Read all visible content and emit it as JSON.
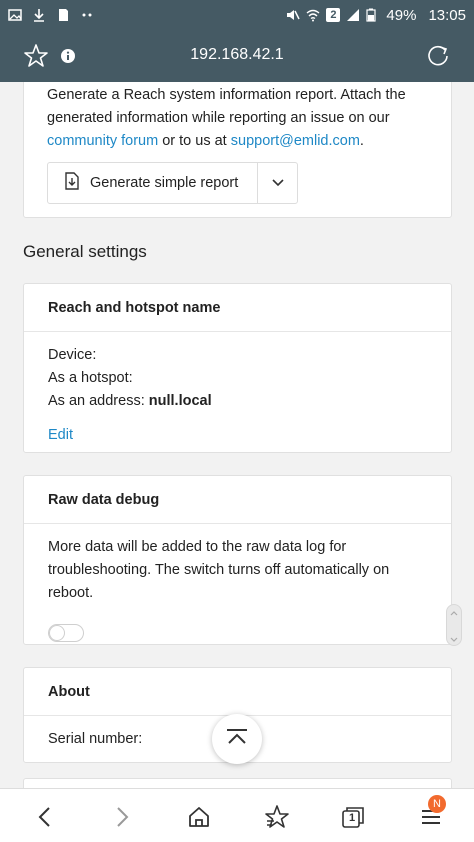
{
  "status_bar": {
    "battery": "49%",
    "time": "13:05",
    "sim_label": "2"
  },
  "browser": {
    "url": "192.168.42.1"
  },
  "report": {
    "text_line1": "Generate a Reach system information report. Attach the",
    "text_line2": "generated information while reporting an issue on our",
    "link_forum": "community forum",
    "text_middle": " or to us at ",
    "link_email": "support@emlid.com",
    "text_end": ".",
    "button_label": "Generate simple report"
  },
  "general_settings": {
    "title": "General settings"
  },
  "hotspot_card": {
    "title": "Reach and hotspot name",
    "device_label": "Device:",
    "hotspot_label": "As a hotspot:",
    "address_label": "As an address:",
    "address_value": "null.local",
    "edit_label": "Edit"
  },
  "raw_debug_card": {
    "title": "Raw data debug",
    "desc_line1": "More data will be added to the raw data log for",
    "desc_line2": "troubleshooting. The switch turns off automatically on",
    "desc_line3": "reboot.",
    "toggle_on": false
  },
  "about_card": {
    "title": "About",
    "serial_label": "Serial number:"
  },
  "bottom_nav": {
    "tabs_count": "1",
    "menu_badge": "N"
  }
}
